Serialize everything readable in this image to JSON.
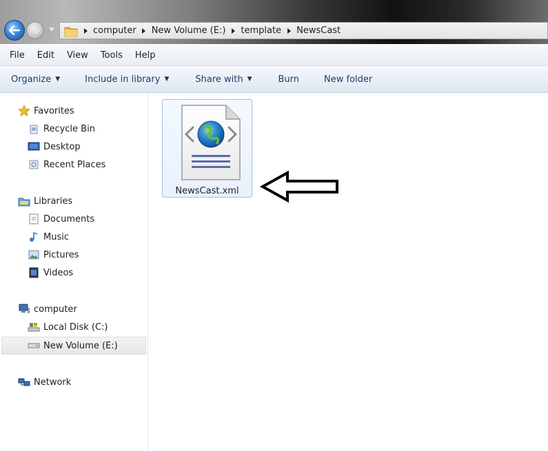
{
  "address": {
    "breadcrumbs": [
      "computer",
      "New Volume (E:)",
      "template",
      "NewsCast"
    ]
  },
  "menu": [
    "File",
    "Edit",
    "View",
    "Tools",
    "Help"
  ],
  "commands": {
    "organize": "Organize",
    "include_in_library": "Include in library",
    "share_with": "Share with",
    "burn": "Burn",
    "new_folder": "New folder"
  },
  "nav": {
    "favorites": "Favorites",
    "recycle_bin": "Recycle Bin",
    "desktop": "Desktop",
    "recent_places": "Recent Places",
    "libraries": "Libraries",
    "documents": "Documents",
    "music": "Music",
    "pictures": "Pictures",
    "videos": "Videos",
    "computer": "computer",
    "local_disk": "Local Disk (C:)",
    "new_volume": "New Volume (E:)",
    "network": "Network"
  },
  "files": [
    {
      "name": "NewsCast.xml",
      "icon": "xml-document-icon"
    }
  ],
  "colors": {
    "accent": "#3b86d8",
    "selection_border": "#99c0e8",
    "command_text": "#1f3a5f"
  }
}
